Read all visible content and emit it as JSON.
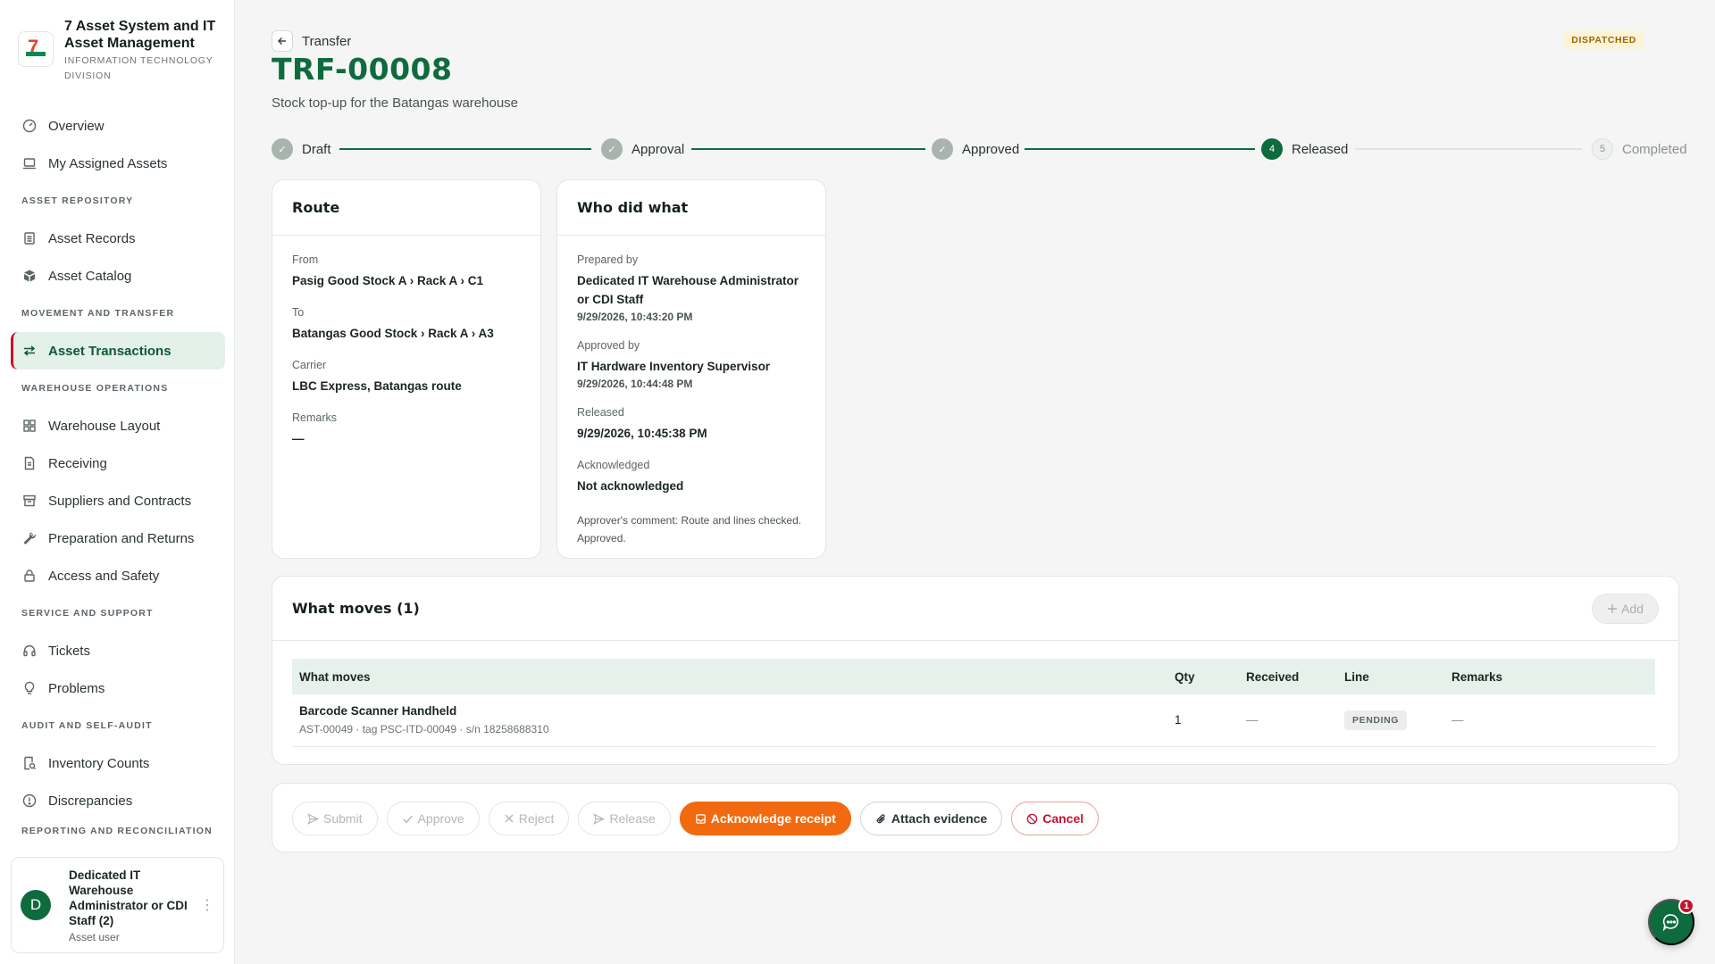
{
  "brand": {
    "title": "7 Asset System and IT Asset Management",
    "subtitle": "INFORMATION TECHNOLOGY DIVISION",
    "logo_text": "7"
  },
  "sidebar": {
    "top_items": [
      {
        "label": "Overview",
        "icon": "gauge-icon"
      },
      {
        "label": "My Assigned Assets",
        "icon": "laptop-icon"
      }
    ],
    "sections": [
      {
        "title": "ASSET REPOSITORY",
        "items": [
          {
            "label": "Asset Records",
            "icon": "list-icon"
          },
          {
            "label": "Asset Catalog",
            "icon": "box-icon"
          }
        ]
      },
      {
        "title": "MOVEMENT AND TRANSFER",
        "items": [
          {
            "label": "Asset Transactions",
            "icon": "arrows-swap-icon",
            "active": true
          }
        ]
      },
      {
        "title": "WAREHOUSE OPERATIONS",
        "items": [
          {
            "label": "Warehouse Layout",
            "icon": "grid-icon"
          },
          {
            "label": "Receiving",
            "icon": "document-icon"
          },
          {
            "label": "Suppliers and Contracts",
            "icon": "store-icon"
          },
          {
            "label": "Preparation and Returns",
            "icon": "wrench-icon"
          },
          {
            "label": "Access and Safety",
            "icon": "lock-icon"
          }
        ]
      },
      {
        "title": "SERVICE AND SUPPORT",
        "items": [
          {
            "label": "Tickets",
            "icon": "headset-icon"
          },
          {
            "label": "Problems",
            "icon": "lightbulb-icon"
          }
        ]
      },
      {
        "title": "AUDIT AND SELF-AUDIT",
        "items": [
          {
            "label": "Inventory Counts",
            "icon": "clipboard-search-icon"
          },
          {
            "label": "Discrepancies",
            "icon": "alert-circle-icon"
          }
        ]
      },
      {
        "title": "REPORTING AND RECONCILIATION",
        "items": []
      }
    ]
  },
  "user": {
    "initial": "D",
    "name": "Dedicated IT Warehouse Administrator or CDI Staff (2)",
    "role": "Asset user",
    "more": "⋮"
  },
  "header": {
    "back_label": "Transfer",
    "title": "TRF-00008",
    "subtitle": "Stock top-up for the Batangas warehouse",
    "status": "DISPATCHED"
  },
  "stepper": [
    {
      "label": "Draft",
      "state": "done",
      "marker": "✓"
    },
    {
      "label": "Approval",
      "state": "done",
      "marker": "✓"
    },
    {
      "label": "Approved",
      "state": "done",
      "marker": "✓"
    },
    {
      "label": "Released",
      "state": "current",
      "marker": "4"
    },
    {
      "label": "Completed",
      "state": "todo",
      "marker": "5"
    }
  ],
  "route": {
    "title": "Route",
    "from_label": "From",
    "from": "Pasig Good Stock A › Rack A › C1",
    "to_label": "To",
    "to": "Batangas Good Stock › Rack A › A3",
    "carrier_label": "Carrier",
    "carrier": "LBC Express, Batangas route",
    "remarks_label": "Remarks",
    "remarks": "—"
  },
  "who": {
    "title": "Who did what",
    "prepared_label": "Prepared by",
    "prepared_by": "Dedicated IT Warehouse Administrator or CDI Staff",
    "prepared_time": "9/29/2026, 10:43:20 PM",
    "approved_label": "Approved by",
    "approved_by": "IT Hardware Inventory Supervisor",
    "approved_time": "9/29/2026, 10:44:48 PM",
    "released_label": "Released",
    "released_time": "9/29/2026, 10:45:38 PM",
    "ack_label": "Acknowledged",
    "ack_value": "Not acknowledged",
    "comment": "Approver's comment: Route and lines checked. Approved."
  },
  "moves": {
    "title": "What moves (1)",
    "add_label": "Add",
    "columns": [
      "What moves",
      "Qty",
      "Received",
      "Line",
      "Remarks"
    ],
    "rows": [
      {
        "name": "Barcode Scanner Handheld",
        "sub": "AST-00049 · tag PSC-ITD-00049 · s/n 18258688310",
        "qty": "1",
        "received": "—",
        "line": "PENDING",
        "remarks": "—"
      }
    ]
  },
  "actions": {
    "submit": "Submit",
    "approve": "Approve",
    "reject": "Reject",
    "release": "Release",
    "acknowledge": "Acknowledge receipt",
    "attach": "Attach evidence",
    "cancel": "Cancel"
  },
  "chat": {
    "badge": "1"
  },
  "colors": {
    "primary": "#0e6b3e",
    "accent": "#f26a10",
    "danger": "#c8102e",
    "status_bg": "#fdf3d8"
  }
}
